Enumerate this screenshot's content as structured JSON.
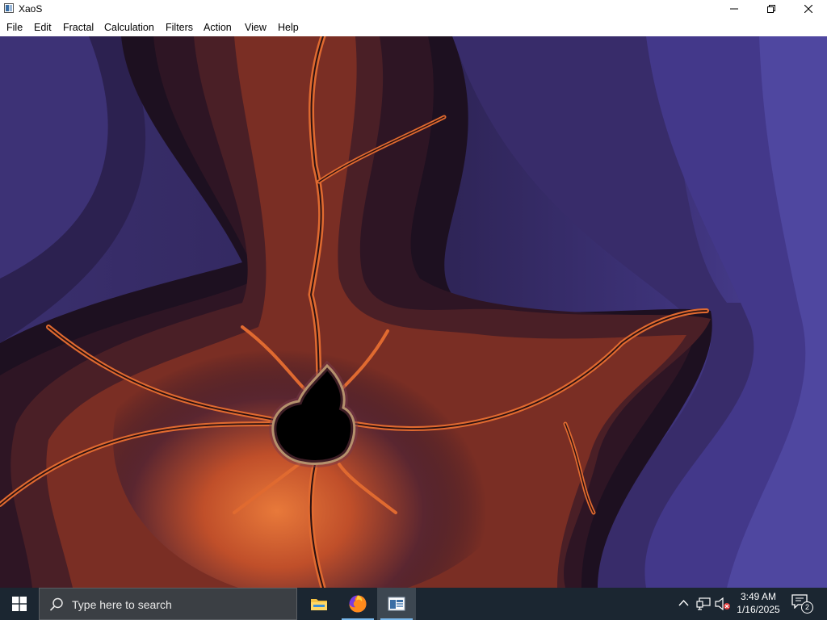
{
  "window": {
    "title": "XaoS",
    "app_icon": "xaos-app-icon",
    "controls": [
      "minimize-icon",
      "restore-icon",
      "close-icon"
    ]
  },
  "menubar": {
    "items": [
      {
        "label": "File"
      },
      {
        "label": "Edit"
      },
      {
        "label": "Fractal"
      },
      {
        "label": "Calculation"
      },
      {
        "label": "Filters"
      },
      {
        "label": "Action"
      },
      {
        "label": "View"
      },
      {
        "label": "Help"
      }
    ]
  },
  "canvas": {
    "content": "mandelbrot-fractal-render",
    "colors": {
      "outer": "#4a3f8f",
      "mid": "#2a1e4a",
      "dark": "#1a0f18",
      "orange": "#d0562a",
      "bright": "#e8793a",
      "set": "#000000",
      "edge": "#f0e890"
    }
  },
  "taskbar": {
    "search_placeholder": "Type here to search",
    "apps": [
      "file-explorer-icon",
      "firefox-icon",
      "xaos-taskbar-icon"
    ],
    "tray": [
      "chevron-up-icon",
      "network-icon",
      "volume-muted-icon"
    ],
    "time": "3:49 AM",
    "date": "1/16/2025",
    "notification_count": "2"
  }
}
